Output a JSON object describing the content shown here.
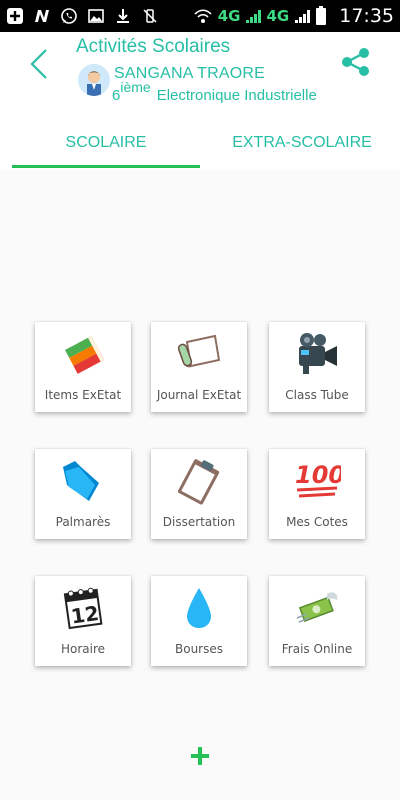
{
  "status_bar": {
    "time": "17:35",
    "network_label_1": "4G",
    "network_label_2": "4G"
  },
  "header": {
    "title": "Activités Scolaires",
    "student_name": "SANGANA TRAORE",
    "class_grade": "6",
    "class_grade_suffix": "ième",
    "class_option": "Electronique Industrielle"
  },
  "tabs": [
    {
      "label": "SCOLAIRE",
      "selected": true
    },
    {
      "label": "EXTRA-SCOLAIRE",
      "selected": false
    }
  ],
  "grid": {
    "items": [
      {
        "label": "Items ExEtat",
        "icon": "books-icon"
      },
      {
        "label": "Journal ExEtat",
        "icon": "scroll-icon"
      },
      {
        "label": "Class Tube",
        "icon": "video-camera-icon"
      },
      {
        "label": "Palmarès",
        "icon": "folder-icon"
      },
      {
        "label": "Dissertation",
        "icon": "clipboard-icon"
      },
      {
        "label": "Mes Cotes",
        "icon": "hundred-points-icon"
      },
      {
        "label": "Horaire",
        "icon": "calendar-icon"
      },
      {
        "label": "Bourses",
        "icon": "droplet-icon"
      },
      {
        "label": "Frais Online",
        "icon": "money-with-wings-icon"
      }
    ]
  },
  "colors": {
    "accent": "#26bfa6",
    "tab_indicator": "#22c055",
    "fab": "#22c055"
  }
}
